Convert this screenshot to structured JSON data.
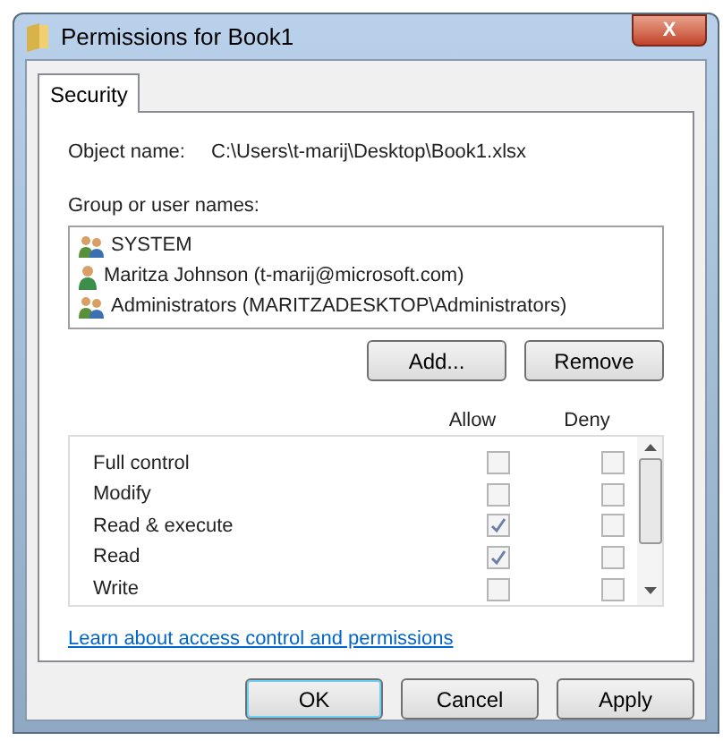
{
  "window": {
    "title": "Permissions for Book1",
    "close": "X"
  },
  "tabs": [
    {
      "label": "Security",
      "selected": true
    }
  ],
  "object_name": {
    "label": "Object name:",
    "value": "C:\\Users\\t-marij\\Desktop\\Book1.xlsx"
  },
  "groups": {
    "label": "Group or user names:",
    "items": [
      {
        "kind": "group",
        "name": "SYSTEM"
      },
      {
        "kind": "user",
        "name": "Maritza Johnson (t-marij@microsoft.com)"
      },
      {
        "kind": "group",
        "name": "Administrators (MARITZADESKTOP\\Administrators)"
      }
    ]
  },
  "group_buttons": [
    "Add...",
    "Remove"
  ],
  "permissions": {
    "allow_label": "Allow",
    "deny_label": "Deny",
    "rows": [
      {
        "name": "Full control",
        "allow": false,
        "deny": false
      },
      {
        "name": "Modify",
        "allow": false,
        "deny": false
      },
      {
        "name": "Read & execute",
        "allow": true,
        "deny": false
      },
      {
        "name": "Read",
        "allow": true,
        "deny": false
      },
      {
        "name": "Write",
        "allow": false,
        "deny": false
      }
    ]
  },
  "link": "Learn about access control and permissions",
  "buttons": [
    {
      "label": "OK",
      "default": true
    },
    {
      "label": "Cancel",
      "default": false
    },
    {
      "label": "Apply",
      "default": false
    }
  ]
}
